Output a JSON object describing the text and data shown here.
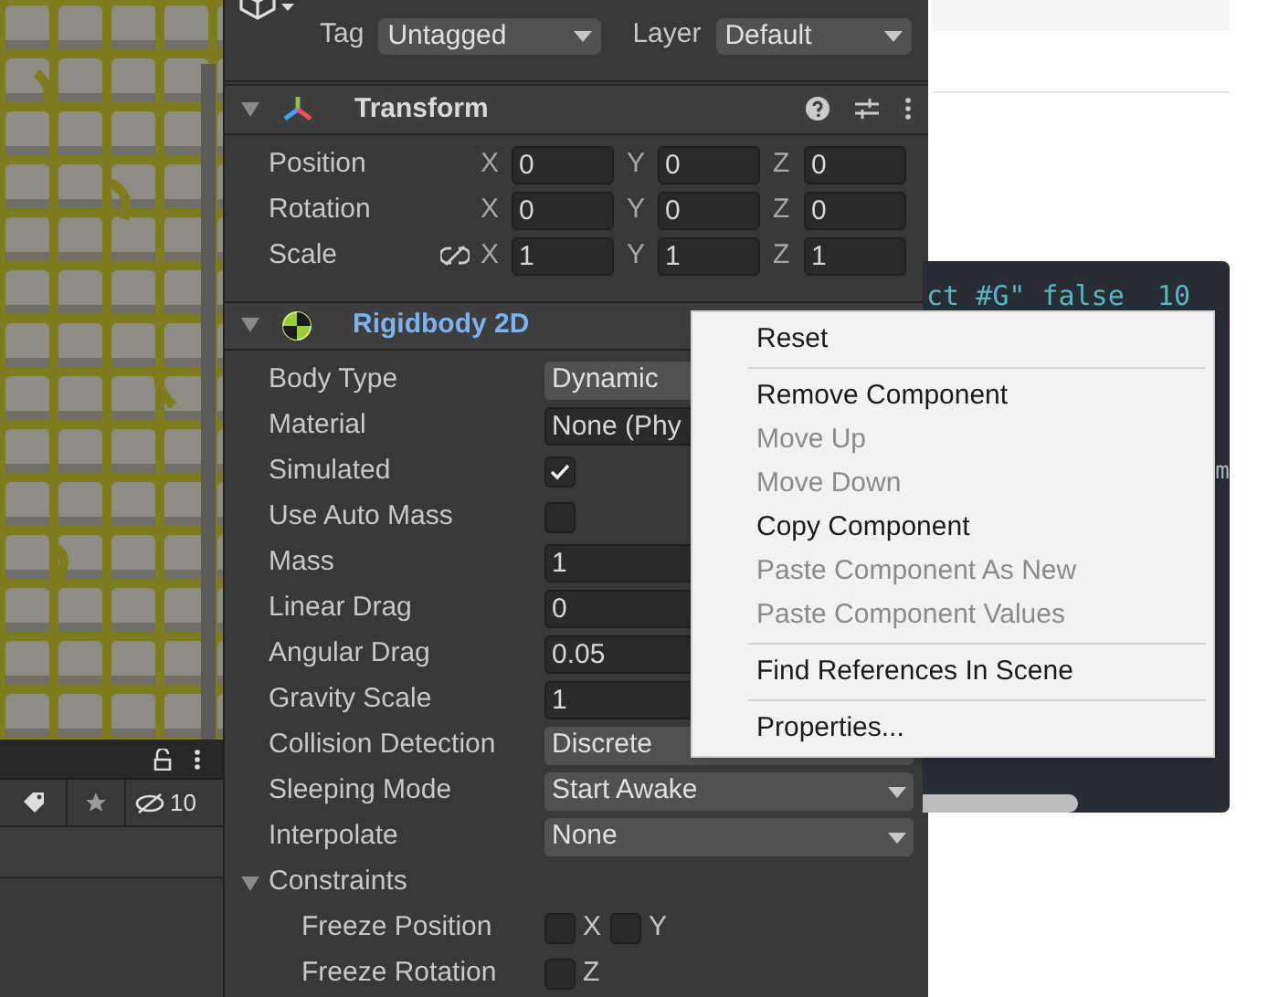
{
  "hierarchy_toolbar": {
    "hidden_count": "10"
  },
  "inspector": {
    "tag": {
      "label": "Tag",
      "value": "Untagged"
    },
    "layer": {
      "label": "Layer",
      "value": "Default"
    },
    "transform": {
      "title": "Transform",
      "expanded": true,
      "rows": [
        {
          "label": "Position",
          "linked": false,
          "values": [
            {
              "axis": "X",
              "value": "0"
            },
            {
              "axis": "Y",
              "value": "0"
            },
            {
              "axis": "Z",
              "value": "0"
            }
          ]
        },
        {
          "label": "Rotation",
          "linked": false,
          "values": [
            {
              "axis": "X",
              "value": "0"
            },
            {
              "axis": "Y",
              "value": "0"
            },
            {
              "axis": "Z",
              "value": "0"
            }
          ]
        },
        {
          "label": "Scale",
          "linked": true,
          "values": [
            {
              "axis": "X",
              "value": "1"
            },
            {
              "axis": "Y",
              "value": "1"
            },
            {
              "axis": "Z",
              "value": "1"
            }
          ]
        }
      ]
    },
    "rigidbody": {
      "title": "Rigidbody 2D",
      "expanded": true,
      "properties": [
        {
          "kind": "dropdown",
          "label": "Body Type",
          "value": "Dynamic",
          "arrow": false
        },
        {
          "kind": "object",
          "label": "Material",
          "value": "None (Phy"
        },
        {
          "kind": "checkbox",
          "label": "Simulated",
          "checked": true
        },
        {
          "kind": "checkbox",
          "label": "Use Auto Mass",
          "checked": false
        },
        {
          "kind": "number",
          "label": "Mass",
          "value": "1"
        },
        {
          "kind": "number",
          "label": "Linear Drag",
          "value": "0"
        },
        {
          "kind": "number",
          "label": "Angular Drag",
          "value": "0.05"
        },
        {
          "kind": "number",
          "label": "Gravity Scale",
          "value": "1"
        },
        {
          "kind": "dropdown",
          "label": "Collision Detection",
          "value": "Discrete",
          "arrow": false
        },
        {
          "kind": "dropdown",
          "label": "Sleeping Mode",
          "value": "Start Awake",
          "arrow": true
        },
        {
          "kind": "dropdown",
          "label": "Interpolate",
          "value": "None",
          "arrow": true
        },
        {
          "kind": "group",
          "label": "Constraints",
          "expanded": true
        },
        {
          "kind": "axes",
          "label": "Freeze Position",
          "checks": [
            {
              "axis": "X",
              "checked": false
            },
            {
              "axis": "Y",
              "checked": false
            }
          ]
        },
        {
          "kind": "axes",
          "label": "Freeze Rotation",
          "checks": [
            {
              "axis": "Z",
              "checked": false
            }
          ]
        }
      ]
    }
  },
  "code_block": {
    "line": "ct #G\" false  10",
    "fragment": "m"
  },
  "context_menu": {
    "groups": [
      {
        "items": [
          {
            "label": "Reset",
            "disabled": false
          }
        ]
      },
      {
        "items": [
          {
            "label": "Remove Component",
            "disabled": false
          },
          {
            "label": "Move Up",
            "disabled": true
          },
          {
            "label": "Move Down",
            "disabled": true
          },
          {
            "label": "Copy Component",
            "disabled": false
          },
          {
            "label": "Paste Component As New",
            "disabled": true
          },
          {
            "label": "Paste Component Values",
            "disabled": true
          }
        ]
      },
      {
        "items": [
          {
            "label": "Find References In Scene",
            "disabled": false
          }
        ]
      },
      {
        "items": [
          {
            "label": "Properties...",
            "disabled": false
          }
        ]
      }
    ]
  }
}
